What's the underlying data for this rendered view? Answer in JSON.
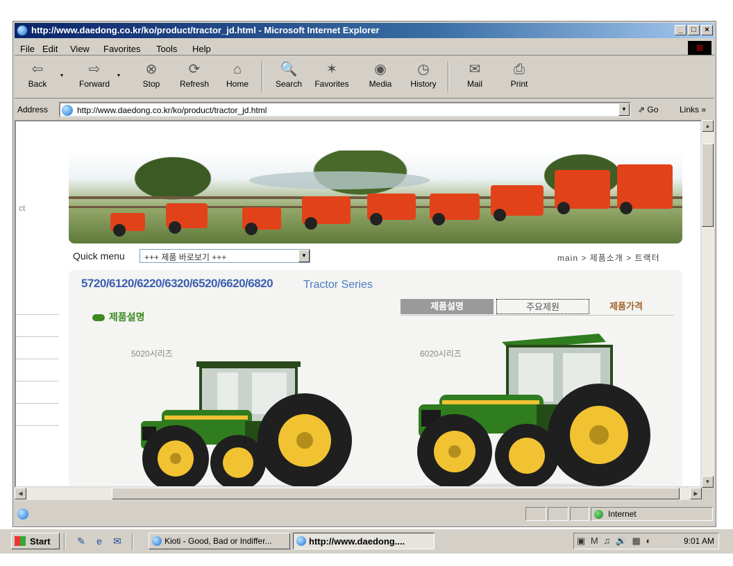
{
  "window": {
    "title": "http://www.daedong.co.kr/ko/product/tractor_jd.html - Microsoft Internet Explorer",
    "controls": [
      "_",
      "□",
      "×"
    ]
  },
  "menu": [
    "File",
    "Edit",
    "View",
    "Favorites",
    "Tools",
    "Help"
  ],
  "toolbar": {
    "back": "Back",
    "forward": "Forward",
    "stop": "Stop",
    "refresh": "Refresh",
    "home": "Home",
    "search": "Search",
    "favorites": "Favorites",
    "media": "Media",
    "history": "History",
    "mail": "Mail",
    "print": "Print"
  },
  "address": {
    "label": "Address",
    "url": "http://www.daedong.co.kr/ko/product/tractor_jd.html",
    "go": "Go",
    "links": "Links »"
  },
  "page": {
    "left_fragment": "ct",
    "quick_menu_label": "Quick menu",
    "quick_menu_value": "+++ 제품 바로보기 +++",
    "breadcrumb": "main > 제품소개 > 트랙터",
    "models": "5720/6120/6220/6320/6520/6620/6820",
    "series": "Tractor Series",
    "tabs": [
      "제품설명",
      "주요제원",
      "제품가격"
    ],
    "section_title": "제품설명",
    "caption_left": "5020시리즈",
    "caption_right": "6020시리즈",
    "colors": {
      "accent_blue": "#3a5fb0",
      "section_green": "#3c8a22",
      "tractor_green": "#2f7d1f",
      "tractor_yellow": "#f1c232"
    }
  },
  "status": {
    "zone": "Internet"
  },
  "taskbar": {
    "start": "Start",
    "tasks": [
      "Kioti - Good, Bad or Indiffer...",
      "http://www.daedong...."
    ],
    "clock": "9:01 AM"
  }
}
